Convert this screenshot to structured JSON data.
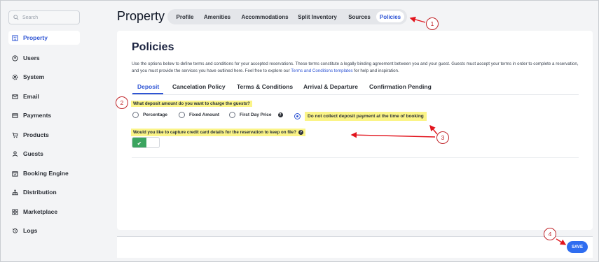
{
  "sidebar": {
    "search_placeholder": "Search",
    "items": [
      {
        "label": "Property",
        "icon": "building-icon",
        "active": true
      },
      {
        "label": "Users",
        "icon": "user-circle-icon",
        "active": false
      },
      {
        "label": "System",
        "icon": "gear-icon",
        "active": false
      },
      {
        "label": "Email",
        "icon": "envelope-icon",
        "active": false
      },
      {
        "label": "Payments",
        "icon": "card-icon",
        "active": false
      },
      {
        "label": "Products",
        "icon": "cart-icon",
        "active": false
      },
      {
        "label": "Guests",
        "icon": "person-icon",
        "active": false
      },
      {
        "label": "Booking Engine",
        "icon": "calendar-icon",
        "active": false
      },
      {
        "label": "Distribution",
        "icon": "network-icon",
        "active": false
      },
      {
        "label": "Marketplace",
        "icon": "grid-icon",
        "active": false
      },
      {
        "label": "Logs",
        "icon": "history-icon",
        "active": false
      }
    ]
  },
  "header": {
    "title": "Property",
    "tabs": [
      {
        "label": "Profile",
        "active": false
      },
      {
        "label": "Amenities",
        "active": false
      },
      {
        "label": "Accommodations",
        "active": false
      },
      {
        "label": "Split Inventory",
        "active": false
      },
      {
        "label": "Sources",
        "active": false
      },
      {
        "label": "Policies",
        "active": true
      }
    ]
  },
  "main": {
    "title": "Policies",
    "description": "Use the options below to define terms and conditions for your accepted reservations. These terms constitute a legally binding agreement between you and your guest. Guests must accept your terms in order to complete a reservation, and you must provide the services you have outlined here. Feel free to explore our",
    "description_link": "Terms and Conditions templates",
    "description_end": "for help and inspiration.",
    "subtabs": [
      {
        "label": "Deposit",
        "active": true
      },
      {
        "label": "Cancelation Policy",
        "active": false
      },
      {
        "label": "Terms & Conditions",
        "active": false
      },
      {
        "label": "Arrival & Departure",
        "active": false
      },
      {
        "label": "Confirmation Pending",
        "active": false
      }
    ],
    "deposit_question": "What deposit amount do you want to charge the guests?",
    "deposit_options": [
      {
        "label": "Percentage",
        "checked": false
      },
      {
        "label": "Fixed Amount",
        "checked": false
      },
      {
        "label": "First Day Price",
        "checked": false
      },
      {
        "label": "Do not collect deposit payment at the time of booking",
        "checked": true
      }
    ],
    "card_question": "Would you like to capture credit card details for the reservation to keep on file?",
    "card_toggle_on": true
  },
  "footer": {
    "save_label": "SAVE"
  },
  "callouts": [
    "1",
    "2",
    "3",
    "4"
  ],
  "colors": {
    "accent": "#2f55d4",
    "highlight": "#fbf487",
    "annotation": "#c0252a",
    "toggle_on": "#3ba45f",
    "save_button": "#2f6df0"
  }
}
